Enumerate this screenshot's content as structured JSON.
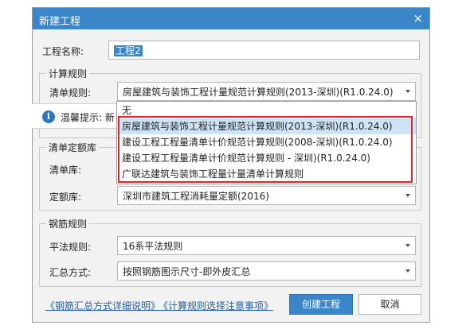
{
  "dialog": {
    "title": "新建工程",
    "close_glyph": "×"
  },
  "project_name": {
    "label": "工程名称:",
    "value": "工程2"
  },
  "calc_rules": {
    "legend": "计算规则",
    "bill_rule_label": "清单规则:",
    "bill_rule_value": "房屋建筑与装饰工程计量规范计算规则(2013-深圳)(R1.0.24.0)"
  },
  "tip": {
    "icon_glyph": "i",
    "text": "温馨提示: 新"
  },
  "dropdown": {
    "options": [
      "无",
      "房屋建筑与装饰工程计量规范计算规则(2013-深圳)(R1.0.24.0)",
      "建设工程工程量清单计价规范计算规则(2008-深圳)(R1.0.24.0)",
      "建设工程工程量清单计价规范计算规则 - 深圳)(R1.0.24.0)",
      "广联达建筑与装饰工程量计量清单计算规则"
    ],
    "selected_index": 1
  },
  "quota_lib": {
    "legend": "清单定额库",
    "bill_lib_label": "清单库:",
    "quota_label": "定额库:",
    "quota_value": "深圳市建筑工程消耗量定额(2016)"
  },
  "rebar_rules": {
    "legend": "钢筋规则",
    "flat_label": "平法规则:",
    "flat_value": "16系平法规则",
    "summary_label": "汇总方式:",
    "summary_value": "按照钢筋图示尺寸-即外皮汇总"
  },
  "footer": {
    "link1": "《钢筋汇总方式详细说明》",
    "link2": "《计算规则选择注意事项》",
    "create_button": "创建工程",
    "cancel_button": "取消"
  },
  "colors": {
    "title_bar": "#3a86c8",
    "highlight_border": "#e0262a",
    "selected_option": "#cde4f7",
    "link": "#1f5fb0"
  }
}
